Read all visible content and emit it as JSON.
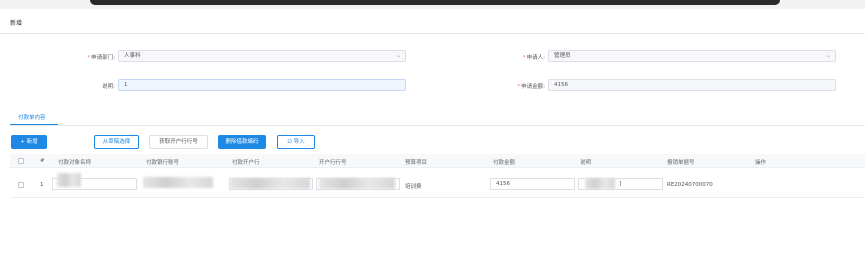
{
  "page": {
    "title": "新增"
  },
  "form": {
    "dept": {
      "label": "申请部门:",
      "value": "人事科"
    },
    "applicant": {
      "label": "申请人:",
      "value": "管理员"
    },
    "description": {
      "label": "说明:",
      "value": "1"
    },
    "amount": {
      "label": "申请金额:",
      "value": "4156"
    }
  },
  "tabs": [
    {
      "label": "付款单内容"
    }
  ],
  "toolbar": {
    "add": "新增",
    "from_draft": "从草稿选择",
    "get_bank": "获取开户行行号",
    "clear_code": "删除借款编码",
    "import": "导入"
  },
  "table": {
    "headers": [
      "#",
      "付款对象名称",
      "付款银行账号",
      "付款开户行",
      "开户行行号",
      "预算项目",
      "付款金额",
      "说明",
      "报销单据号",
      "操作"
    ],
    "rows": [
      {
        "index": "1",
        "budget_item": "培训费",
        "amount": "4156",
        "desc_suffix": "]",
        "reimb_no": "RE20240700070"
      }
    ]
  },
  "colors": {
    "primary": "#1e88e5",
    "required": "#f56c6c"
  }
}
